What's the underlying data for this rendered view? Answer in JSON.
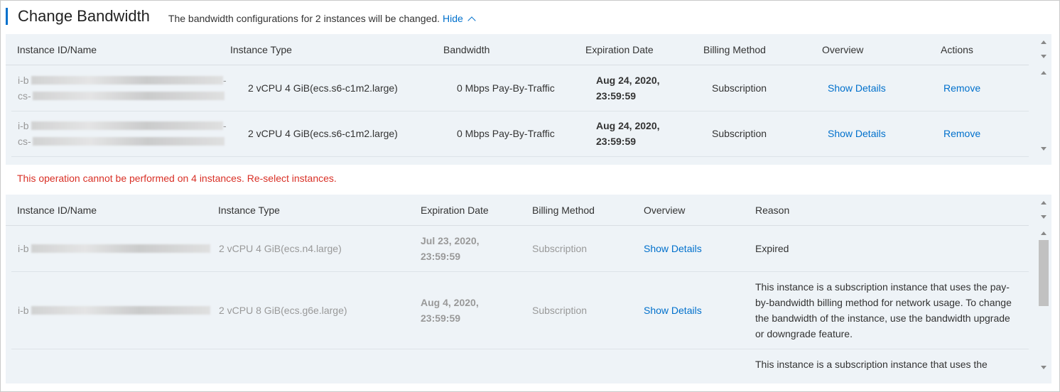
{
  "header": {
    "title": "Change Bandwidth",
    "description": "The bandwidth configurations for 2 instances will be changed.",
    "hide_label": "Hide"
  },
  "valid_table": {
    "columns": [
      "Instance ID/Name",
      "Instance Type",
      "Bandwidth",
      "Expiration Date",
      "Billing Method",
      "Overview",
      "Actions"
    ],
    "rows": [
      {
        "id_prefix_1": "i-b",
        "id_suffix_1": "-",
        "id_prefix_2": "cs-",
        "type": "2 vCPU 4 GiB(ecs.s6-c1m2.large)",
        "bandwidth": "0 Mbps Pay-By-Traffic",
        "date_1": "Aug 24, 2020,",
        "date_2": "23:59:59",
        "billing": "Subscription",
        "overview": "Show Details",
        "action": "Remove"
      },
      {
        "id_prefix_1": "i-b",
        "id_suffix_1": "-",
        "id_prefix_2": "cs-",
        "type": "2 vCPU 4 GiB(ecs.s6-c1m2.large)",
        "bandwidth": "0 Mbps Pay-By-Traffic",
        "date_1": "Aug 24, 2020,",
        "date_2": "23:59:59",
        "billing": "Subscription",
        "overview": "Show Details",
        "action": "Remove"
      }
    ]
  },
  "error_message": "This operation cannot be performed on 4 instances. Re-select instances.",
  "invalid_table": {
    "columns": [
      "Instance ID/Name",
      "Instance Type",
      "Expiration Date",
      "Billing Method",
      "Overview",
      "Reason"
    ],
    "rows": [
      {
        "id_prefix": "i-b",
        "type": "2 vCPU 4 GiB(ecs.n4.large)",
        "date_1": "Jul 23, 2020,",
        "date_2": "23:59:59",
        "billing": "Subscription",
        "overview": "Show Details",
        "reason": "Expired"
      },
      {
        "id_prefix": "i-b",
        "type": "2 vCPU 8 GiB(ecs.g6e.large)",
        "date_1": "Aug 4, 2020,",
        "date_2": "23:59:59",
        "billing": "Subscription",
        "overview": "Show Details",
        "reason": "This instance is a subscription instance that uses the pay-by-bandwidth billing method for network usage. To change the bandwidth of the instance, use the bandwidth upgrade or downgrade feature."
      },
      {
        "reason": "This instance is a subscription instance that uses the"
      }
    ]
  },
  "icons": {
    "hide": "chevron-up-icon",
    "scroll_up": "scroll-up-arrow-icon",
    "scroll_down": "scroll-down-arrow-icon"
  },
  "colors": {
    "accent": "#0070cc",
    "error": "#d93026",
    "table_bg": "#eef3f7"
  }
}
